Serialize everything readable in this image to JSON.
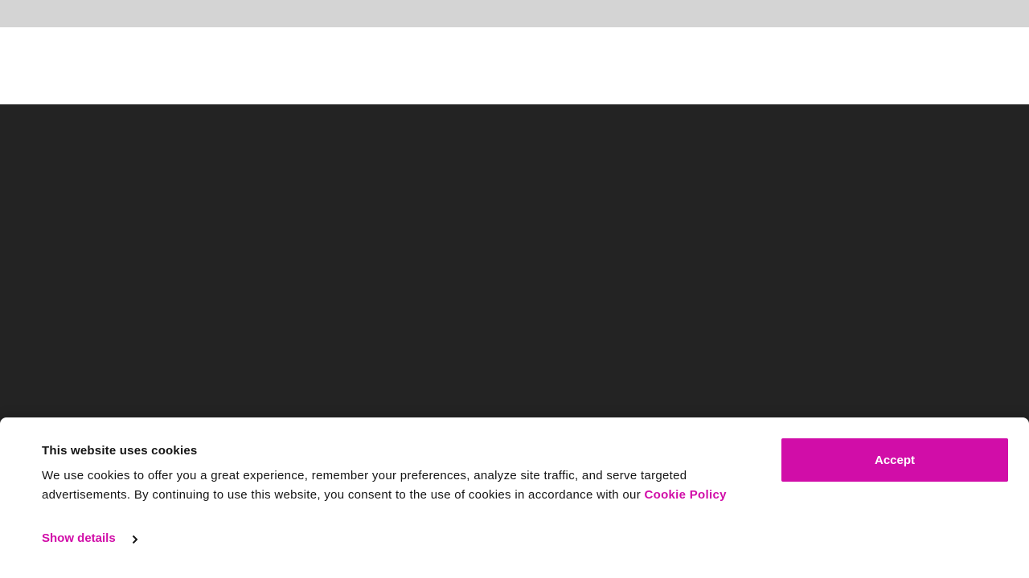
{
  "cookie_banner": {
    "title": "This website uses cookies",
    "body_text": "We use cookies to offer you a great experience, remember your preferences, analyze site traffic, and serve targeted advertisements. By continuing to use this website, you consent to the use of cookies in accordance with our ",
    "policy_link": "Cookie Policy",
    "show_details": "Show details",
    "accept_label": "Accept"
  },
  "colors": {
    "accent": "#d10da8",
    "hero_background": "#232323",
    "top_strip": "#d4d4d4"
  },
  "icons": {
    "show_details_icon": "chevron-right-icon"
  }
}
